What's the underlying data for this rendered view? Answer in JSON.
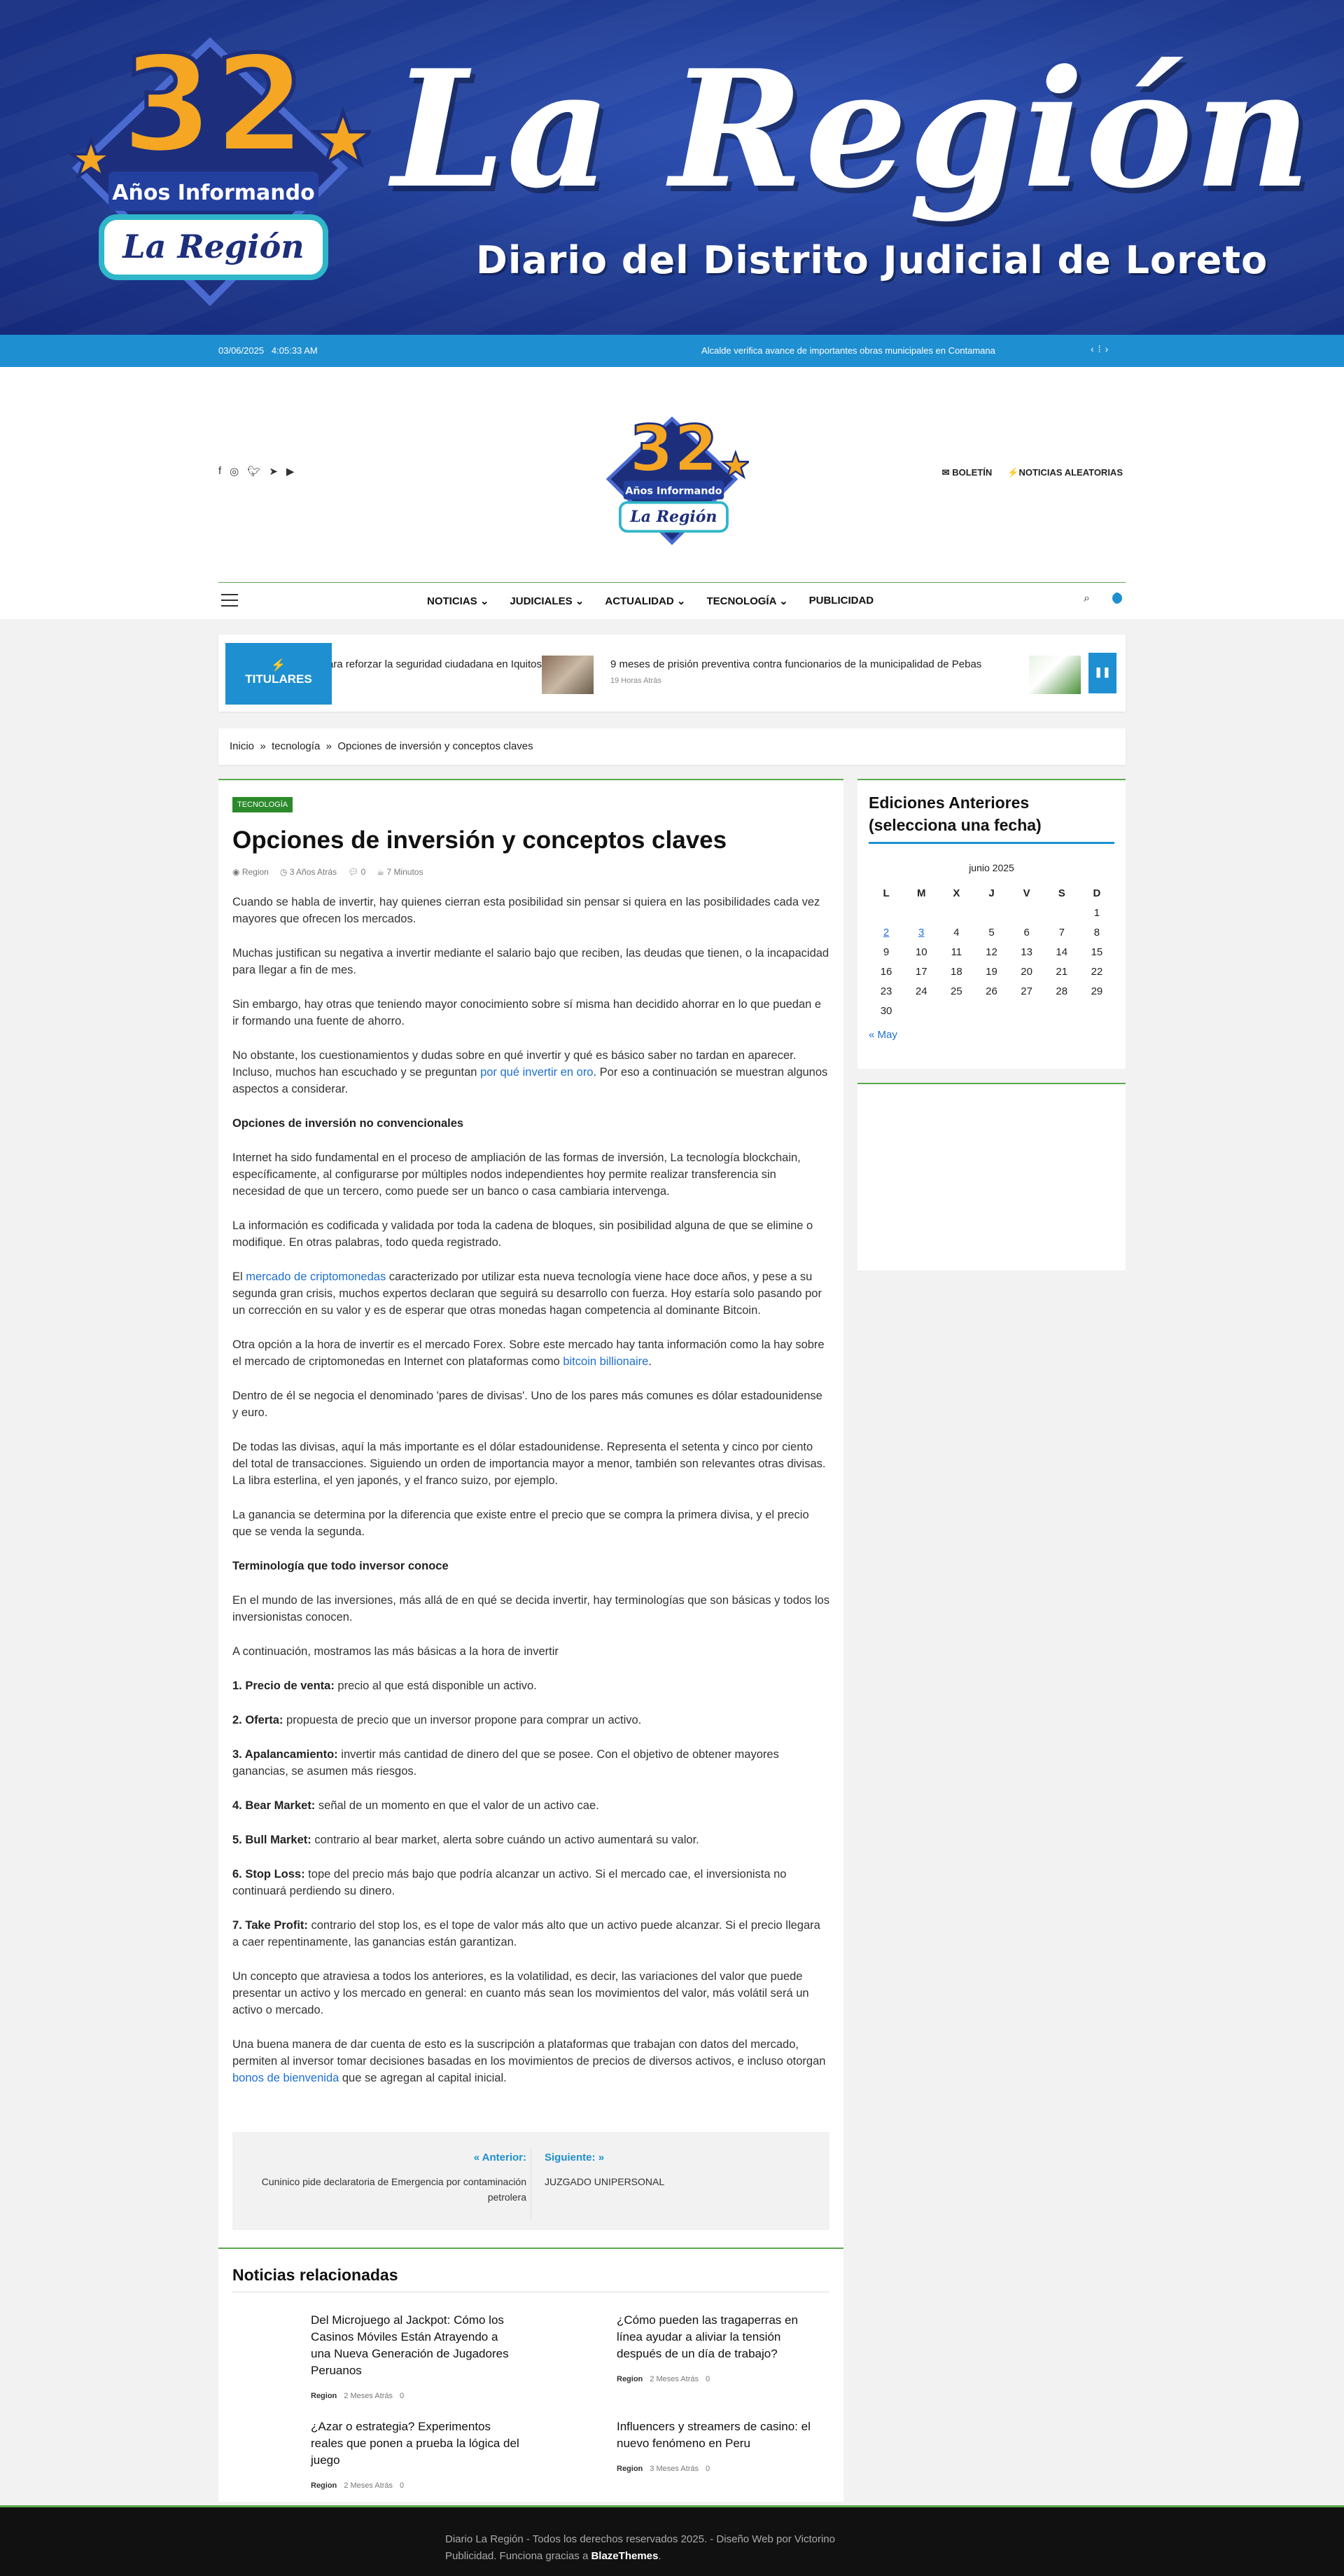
{
  "banner": {
    "badge_number": "32",
    "badge_line1": "Años Informando",
    "badge_line2": "La Región",
    "title": "La Región",
    "subtitle": "Diario del Distrito Judicial de Loreto"
  },
  "topbar": {
    "date": "03/06/2025",
    "time": "4:05:33 AM",
    "ticker": "Alcalde verifica avance de importantes obras municipales en Contamana"
  },
  "header": {
    "logo_number": "32",
    "logo_line1": "Años Informando",
    "logo_line2": "La Región",
    "links": [
      "BOLETÍN",
      "NOTICIAS ALEATORIAS"
    ]
  },
  "nav": {
    "items": [
      "NOTICIAS",
      "JUDICIALES",
      "ACTUALIDAD",
      "TECNOLOGÍA",
      "PUBLICIDAD"
    ]
  },
  "titulares": {
    "label": "TITULARES",
    "item1": "Refuerzan estrategias para reforzar la seguridad ciudadana en Iquitos",
    "item2": "9 meses de prisión preventiva contra funcionarios de la municipalidad de Pebas",
    "item2_time": "19 Horas Atrás"
  },
  "breadcrumb": [
    "Inicio",
    "tecnología",
    "Opciones de inversión y conceptos claves"
  ],
  "article": {
    "category": "TECNOLOGÍA",
    "title": "Opciones de inversión y conceptos claves",
    "author": "Region",
    "time": "3 Años Atrás",
    "comments": "0",
    "read": "7 Minutos",
    "p1": "Cuando se habla de invertir, hay quienes cierran esta posibilidad sin pensar si quiera en las posibilidades cada vez mayores que ofrecen los mercados.",
    "p2": "Muchas justifican su negativa a invertir mediante el salario bajo que reciben, las deudas que tienen, o la incapacidad para llegar a fin de mes.",
    "p3": "Sin embargo, hay otras que teniendo mayor conocimiento sobre sí misma han decidido ahorrar en lo que puedan e ir formando una fuente de ahorro.",
    "p4a": "No obstante, los cuestionamientos y dudas sobre en qué invertir y qué es básico saber no tardan en aparecer. Incluso, muchos han escuchado y se preguntan ",
    "p4link": "por qué invertir en oro",
    "p4b": ". Por eso a continuación se muestran algunos aspectos a considerar.",
    "h1": "Opciones de inversión no convencionales",
    "p5": "Internet ha sido fundamental en el proceso de ampliación de las formas de inversión, La tecnología blockchain, específicamente, al configurarse por múltiples nodos independientes hoy permite realizar transferencia sin necesidad de que un tercero, como puede ser un banco o casa cambiaria intervenga.",
    "p6": "La información es codificada y validada por toda la cadena de bloques, sin posibilidad alguna de que se elimine o modifique. En otras palabras, todo queda registrado.",
    "p7a": "El ",
    "p7link": "mercado de criptomonedas",
    "p7b": " caracterizado por utilizar esta nueva tecnología viene hace doce años, y pese a su segunda gran crisis, muchos expertos declaran que seguirá su desarrollo con fuerza. Hoy estaría solo pasando por un corrección en su valor y es de esperar que otras monedas hagan competencia al dominante Bitcoin.",
    "p8a": "Otra opción a la hora de invertir es el mercado Forex. Sobre este mercado hay tanta información como la hay sobre el mercado de criptomonedas en Internet con plataformas como ",
    "p8link": "bitcoin billionaire",
    "p8b": ".",
    "p9": "Dentro de él se negocia el denominado 'pares de divisas'. Uno de los pares más comunes es dólar estadounidense y euro.",
    "p10": "De todas las divisas, aquí la más importante es el dólar estadounidense. Representa el setenta y cinco por ciento del total de transacciones. Siguiendo un orden de importancia mayor a menor, también son relevantes otras divisas. La libra esterlina, el yen japonés, y el franco suizo, por ejemplo.",
    "p11": "La ganancia se determina por la diferencia que existe entre el precio que se compra la primera divisa, y el precio que se venda la segunda.",
    "h2": "Terminología que todo inversor conoce",
    "p12": "En el mundo de las inversiones, más allá de en qué se decida invertir, hay terminologías que son básicas y todos los inversionistas conocen.",
    "p13": "A continuación, mostramos las más básicas a la hora de invertir",
    "t1b": "1. Precio de venta:",
    "t1": " precio al que está disponible un activo.",
    "t2b": "2. Oferta:",
    "t2": " propuesta de precio que un inversor propone para comprar un activo.",
    "t3b": "3. Apalancamiento:",
    "t3": " invertir más cantidad de dinero del que se posee.  Con el objetivo de obtener mayores ganancias, se asumen más riesgos.",
    "t4b": "4. Bear Market:",
    "t4": " señal de un momento en que el valor de un activo cae.",
    "t5b": "5. Bull Market:",
    "t5": " contrario al bear market, alerta sobre cuándo un activo aumentará su valor.",
    "t6b": "6. Stop Loss:",
    "t6": " tope del precio más bajo que podría alcanzar un activo. Si el mercado cae, el inversionista no continuará perdiendo su dinero.",
    "t7b": "7. Take Profit:",
    "t7": " contrario del stop los, es el tope de valor más alto que un activo puede alcanzar. Si el precio llegara a caer repentinamente, las ganancias están garantizan.",
    "p14": "Un concepto que atraviesa a todos los anteriores, es la volatilidad, es decir, las variaciones del valor que puede presentar un activo y los mercado en general: en cuanto más sean los movimientos del valor, más volátil será un activo o mercado.",
    "p15a": "Una buena manera de dar cuenta de esto es la suscripción a plataformas que trabajan con datos del mercado, permiten al inversor tomar decisiones basadas en los movimientos de precios de diversos activos, e incluso otorgan ",
    "p15link": "bonos de bienvenida",
    "p15b": " que se agregan al capital inicial."
  },
  "postnav": {
    "prev_label": "Anterior:",
    "prev_title": "Cuninico pide declaratoria de Emergencia por contaminación petrolera",
    "next_label": "Siguiente:",
    "next_title": "JUZGADO UNIPERSONAL"
  },
  "related": {
    "heading": "Noticias relacionadas",
    "items": [
      {
        "title": "Del Microjuego al Jackpot: Cómo los Casinos Móviles Están Atrayendo a una Nueva Generación de Jugadores Peruanos",
        "author": "Region",
        "time": "2 Meses Atrás",
        "comments": "0"
      },
      {
        "title": "¿Cómo pueden las tragaperras en línea ayudar a aliviar la tensión después de un día de trabajo?",
        "author": "Region",
        "time": "2 Meses Atrás",
        "comments": "0"
      },
      {
        "title": "¿Azar o estrategia? Experimentos reales que ponen a prueba la lógica del juego",
        "author": "Region",
        "time": "2 Meses Atrás",
        "comments": "0"
      },
      {
        "title": "Influencers y streamers de casino: el nuevo fenómeno en Peru",
        "author": "Region",
        "time": "3 Meses Atrás",
        "comments": "0"
      }
    ]
  },
  "sidebar": {
    "heading": "Ediciones Anteriores (selecciona una fecha)",
    "month": "junio 2025",
    "days": [
      "L",
      "M",
      "X",
      "J",
      "V",
      "S",
      "D"
    ],
    "weeks": [
      [
        "",
        "",
        "",
        "",
        "",
        "",
        "1"
      ],
      [
        "2",
        "3",
        "4",
        "5",
        "6",
        "7",
        "8"
      ],
      [
        "9",
        "10",
        "11",
        "12",
        "13",
        "14",
        "15"
      ],
      [
        "16",
        "17",
        "18",
        "19",
        "20",
        "21",
        "22"
      ],
      [
        "23",
        "24",
        "25",
        "26",
        "27",
        "28",
        "29"
      ],
      [
        "30",
        "",
        "",
        "",
        "",
        "",
        ""
      ]
    ],
    "linked_days": [
      "2",
      "3"
    ],
    "prev_month": "« May"
  },
  "footer": {
    "text1": "Diario La Región - Todos los derechos reservados 2025. - Diseño Web por Victorino Publicidad. Funciona gracias a ",
    "brand": "BlazeThemes",
    "text2": "."
  },
  "colors": {
    "accent": "#1e8fd1",
    "green": "#5aa84e",
    "banner_blue": "#1e3a8f",
    "link": "#1e6fd1"
  }
}
